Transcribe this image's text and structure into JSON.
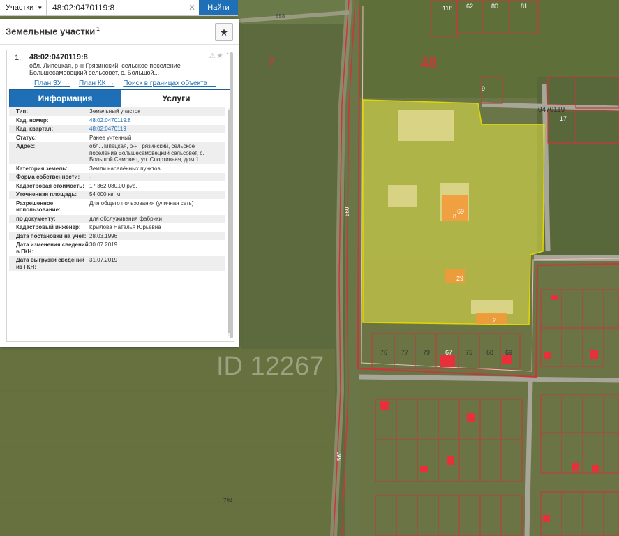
{
  "search": {
    "layer": "Участки",
    "query": "48:02:0470119:8",
    "find_label": "Найти"
  },
  "panel": {
    "title": "Земельные участки",
    "count": "1"
  },
  "result": {
    "number": "1.",
    "title": "48:02:0470119:8",
    "address_short": "обл. Липецкая, р-н Грязинский, сельское поселение Большесамовецкий сельсовет, с. Большой...",
    "links": [
      "План ЗУ →",
      "План КК →",
      "Поиск в границах объекта →"
    ]
  },
  "tabs": {
    "info": "Информация",
    "services": "Услуги"
  },
  "properties": [
    {
      "key": "Тип:",
      "value": "Земельный участок"
    },
    {
      "key": "Кад. номер:",
      "value": "48:02:0470119:8",
      "link": true
    },
    {
      "key": "Кад. квартал:",
      "value": "48:02:0470119",
      "link": true
    },
    {
      "key": "Статус:",
      "value": "Ранее учтенный"
    },
    {
      "key": "Адрес:",
      "value": "обл. Липецкая, р-н Грязинский, сельское поселение Большесамовецкий сельсовет, с. Большой Самовец, ул. Спортивная, дом 1"
    },
    {
      "key": "Категория земель:",
      "value": "Земли населённых пунктов"
    },
    {
      "key": "Форма собственности:",
      "value": "-"
    },
    {
      "key": "Кадастровая стоимость:",
      "value": "17 362 080,00 руб."
    },
    {
      "key": "Уточненная площадь:",
      "value": "54 000 кв. м"
    },
    {
      "key": "Разрешенное использование:",
      "value": "Для общего пользования (уличная сеть)"
    },
    {
      "key": "по документу:",
      "value": "для обслуживания фабрики"
    },
    {
      "key": "Кадастровый инженер:",
      "value": "Крылова Наталья Юрьевна"
    },
    {
      "key": "Дата постановки на учет:",
      "value": "28.03.1996"
    },
    {
      "key": "Дата изменения сведений в ГКН:",
      "value": "30.07.2019"
    },
    {
      "key": "Дата выгрузки сведений из ГКН:",
      "value": "31.07.2019"
    }
  ],
  "map": {
    "labels": [
      "558",
      "2",
      "48",
      "118",
      "62",
      "80",
      "81",
      "0470119",
      "9",
      "17",
      "560",
      "560",
      "794",
      "67",
      "68",
      "69",
      "75",
      "76",
      "77",
      "79",
      "29",
      "2",
      "8",
      "ID 12267"
    ],
    "parcel_fill": "#e8e84a",
    "boundary_color": "#c8383a"
  }
}
